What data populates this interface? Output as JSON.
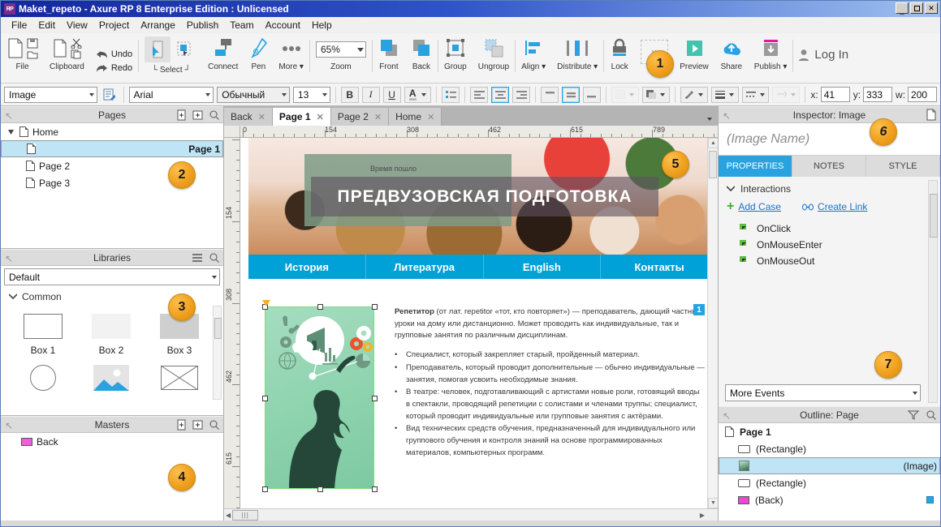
{
  "window": {
    "title": "Maket_repeto - Axure RP 8 Enterprise Edition : Unlicensed",
    "logo": "RP",
    "minimize": "_",
    "maximize": "□",
    "close": "✕"
  },
  "menu": [
    "File",
    "Edit",
    "View",
    "Project",
    "Arrange",
    "Publish",
    "Team",
    "Account",
    "Help"
  ],
  "toolbar": {
    "file_label": "File",
    "clipboard_label": "Clipboard",
    "undo_label": "Undo",
    "redo_label": "Redo",
    "select_label": "Select",
    "connect_label": "Connect",
    "pen_label": "Pen",
    "more_label": "More ▾",
    "zoom_value": "65%",
    "zoom_label": "Zoom",
    "front_label": "Front",
    "back_label": "Back",
    "group_label": "Group",
    "ungroup_label": "Ungroup",
    "align_label": "Align ▾",
    "distribute_label": "Distribute ▾",
    "lock_label": "Lock",
    "overflow_label": "»",
    "preview_label": "Preview",
    "share_label": "Share",
    "publish_label": "Publish ▾",
    "login_label": "Log In"
  },
  "formatbar": {
    "widget_type": "Image",
    "font_family": "Arial",
    "font_style": "Обычный",
    "font_size": "13",
    "bold": "B",
    "italic": "I",
    "underline": "U",
    "font_color": "A",
    "x_label": "x:",
    "x_value": "41",
    "y_label": "y:",
    "y_value": "333",
    "w_label": "w:",
    "w_value": "200"
  },
  "pages_panel": {
    "title": "Pages",
    "items": [
      {
        "label": "Home",
        "depth": 0,
        "selected": false,
        "expanded": true
      },
      {
        "label": "Page 1",
        "depth": 1,
        "selected": true
      },
      {
        "label": "Page 2",
        "depth": 1,
        "selected": false
      },
      {
        "label": "Page 3",
        "depth": 1,
        "selected": false
      }
    ],
    "badge": "2"
  },
  "libraries_panel": {
    "title": "Libraries",
    "selected_library": "Default",
    "group": "Common",
    "widgets": [
      {
        "label": "Box 1",
        "icon": "box-outline"
      },
      {
        "label": "Box 2",
        "icon": "box-light"
      },
      {
        "label": "Box 3",
        "icon": "box-gray"
      },
      {
        "label": "",
        "icon": "ellipse"
      },
      {
        "label": "",
        "icon": "image"
      },
      {
        "label": "",
        "icon": "placeholder"
      }
    ],
    "badge": "3"
  },
  "masters_panel": {
    "title": "Masters",
    "items": [
      {
        "label": "Back"
      }
    ],
    "badge": "4"
  },
  "canvas": {
    "tabs": [
      {
        "label": "Back",
        "active": false
      },
      {
        "label": "Page 1",
        "active": true
      },
      {
        "label": "Page 2",
        "active": false
      },
      {
        "label": "Home",
        "active": false
      }
    ],
    "ruler_h": [
      "0",
      "154",
      "308",
      "462",
      "615",
      "789"
    ],
    "ruler_v": [
      "154",
      "308",
      "462",
      "615"
    ],
    "badge": "5",
    "hero": {
      "subtitle": "Время пошло",
      "title": "ПРЕДВУЗОВСКАЯ  ПОДГОТОВКА"
    },
    "nav": [
      "История",
      "Литература",
      "English",
      "Контакты"
    ],
    "selected_badge": "1",
    "article": {
      "lead_bold": "Репетитор",
      "lead_rest": " (от лат. repetitor «тот, кто повторяет») — преподаватель, дающий частные уроки на дому или дистанционно. Может проводить как индивидуальные, так и групповые занятия по различным дисциплинам.",
      "bullets": [
        "Специалист, который закрепляет старый, пройденный материал.",
        "Преподаватель, который проводит дополнительные — обычно индивидуальные — занятия, помогая усвоить необходимые знания.",
        "В театре: человек, подготавливающий с артистами новые роли, готовящий вводы в спектакли, проводящий репетиции с солистами и членами труппы; специалист, который проводит индивидуальные или групповые занятия с актёрами.",
        "Вид технических средств обучения, предназначенный для индивидуального или группового обучения и контроля знаний на основе программированных материалов, компьютерных программ."
      ]
    }
  },
  "inspector": {
    "title": "Inspector: Image",
    "name_placeholder": "(Image Name)",
    "tabs": [
      {
        "label": "PROPERTIES",
        "active": true
      },
      {
        "label": "NOTES",
        "active": false
      },
      {
        "label": "STYLE",
        "active": false
      }
    ],
    "section": "Interactions",
    "add_case": "Add Case",
    "create_link": "Create Link",
    "events": [
      "OnClick",
      "OnMouseEnter",
      "OnMouseOut"
    ],
    "more_events": "More Events",
    "badge": "6"
  },
  "outline": {
    "title": "Outline: Page",
    "items": [
      {
        "label": "Page 1",
        "icon": "page-icon",
        "root": true,
        "selected": false
      },
      {
        "label": "(Rectangle)",
        "icon": "rect-icon",
        "selected": false
      },
      {
        "label": "(Image)",
        "icon": "image-icon",
        "selected": true
      },
      {
        "label": "(Rectangle)",
        "icon": "rect-icon",
        "selected": false
      },
      {
        "label": "(Back)",
        "icon": "master-icon",
        "selected": false,
        "dot": true
      }
    ],
    "badge": "7"
  },
  "badges": {
    "one": "1"
  },
  "colors": {
    "accent": "#29a3e0",
    "badge": "#f0a01e",
    "titlebar": "#14269c",
    "nav": "#00a0d8",
    "link": "#1a73c8"
  }
}
